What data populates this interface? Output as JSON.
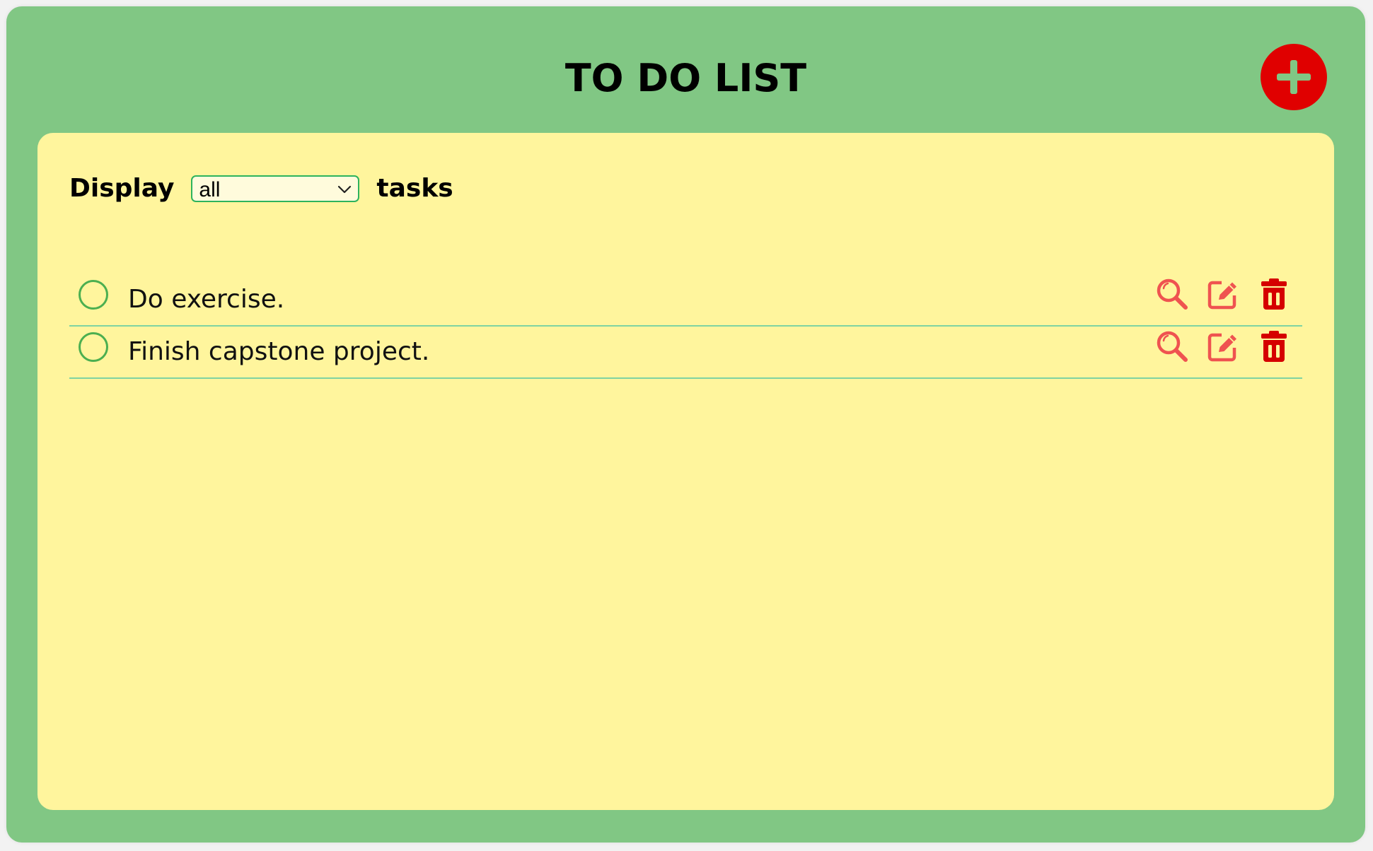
{
  "app": {
    "title": "TO DO LIST",
    "add_icon": "plus-circle-icon",
    "colors": {
      "background": "#81c784",
      "panel": "#fff59d",
      "accent_red": "#e00000",
      "icon_red": "#ef5350",
      "check_green": "#4caf50"
    }
  },
  "filter": {
    "label_prefix": "Display",
    "selected": "all",
    "label_suffix": "tasks"
  },
  "tasks": [
    {
      "text": "Do exercise.",
      "completed": false
    },
    {
      "text": "Finish capstone project.",
      "completed": false
    }
  ],
  "task_actions": [
    "search-icon",
    "edit-icon",
    "trash-icon"
  ]
}
